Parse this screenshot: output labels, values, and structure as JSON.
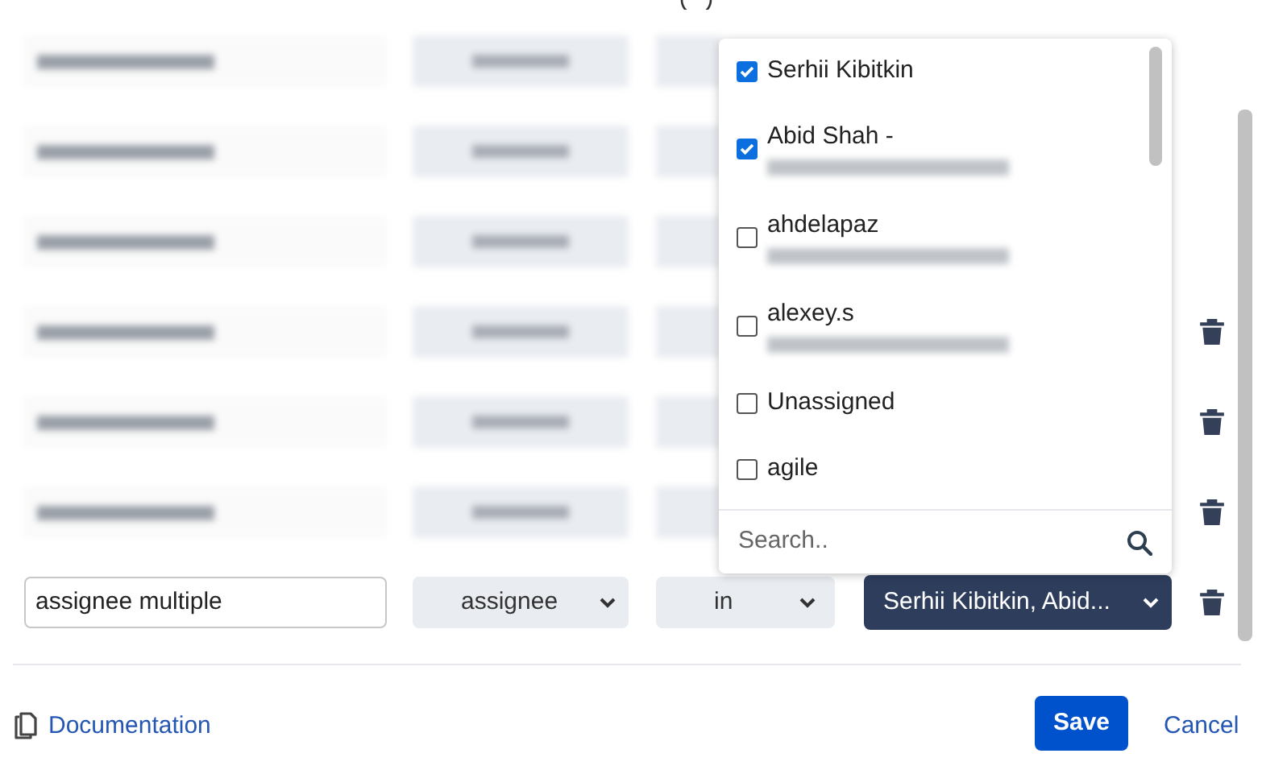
{
  "rows": [
    {
      "kind": "redacted",
      "deletable": false
    },
    {
      "kind": "redacted",
      "deletable": false
    },
    {
      "kind": "redacted",
      "deletable": false
    },
    {
      "kind": "redacted",
      "deletable": true
    },
    {
      "kind": "redacted",
      "deletable": true
    },
    {
      "kind": "redacted",
      "deletable": true
    },
    {
      "kind": "filter",
      "name": "assignee multiple",
      "field": "assignee",
      "operator": "in",
      "value": "Serhii Kibitkin, Abid...",
      "deletable": true
    }
  ],
  "dropdown": {
    "items": [
      {
        "label": "Serhii Kibitkin",
        "checked": true,
        "email_redacted": false
      },
      {
        "label": "Abid Shah -",
        "checked": true,
        "email_redacted": true
      },
      {
        "label": "ahdelapaz",
        "checked": false,
        "email_redacted": true
      },
      {
        "label": "alexey.s",
        "checked": false,
        "email_redacted": true
      },
      {
        "label": "Unassigned",
        "checked": false,
        "email_redacted": false
      },
      {
        "label": "agile",
        "checked": false,
        "email_redacted": false
      }
    ],
    "search": {
      "placeholder": "Search.."
    }
  },
  "footer": {
    "link": "Documentation",
    "save": "Save",
    "cancel": "Cancel"
  }
}
